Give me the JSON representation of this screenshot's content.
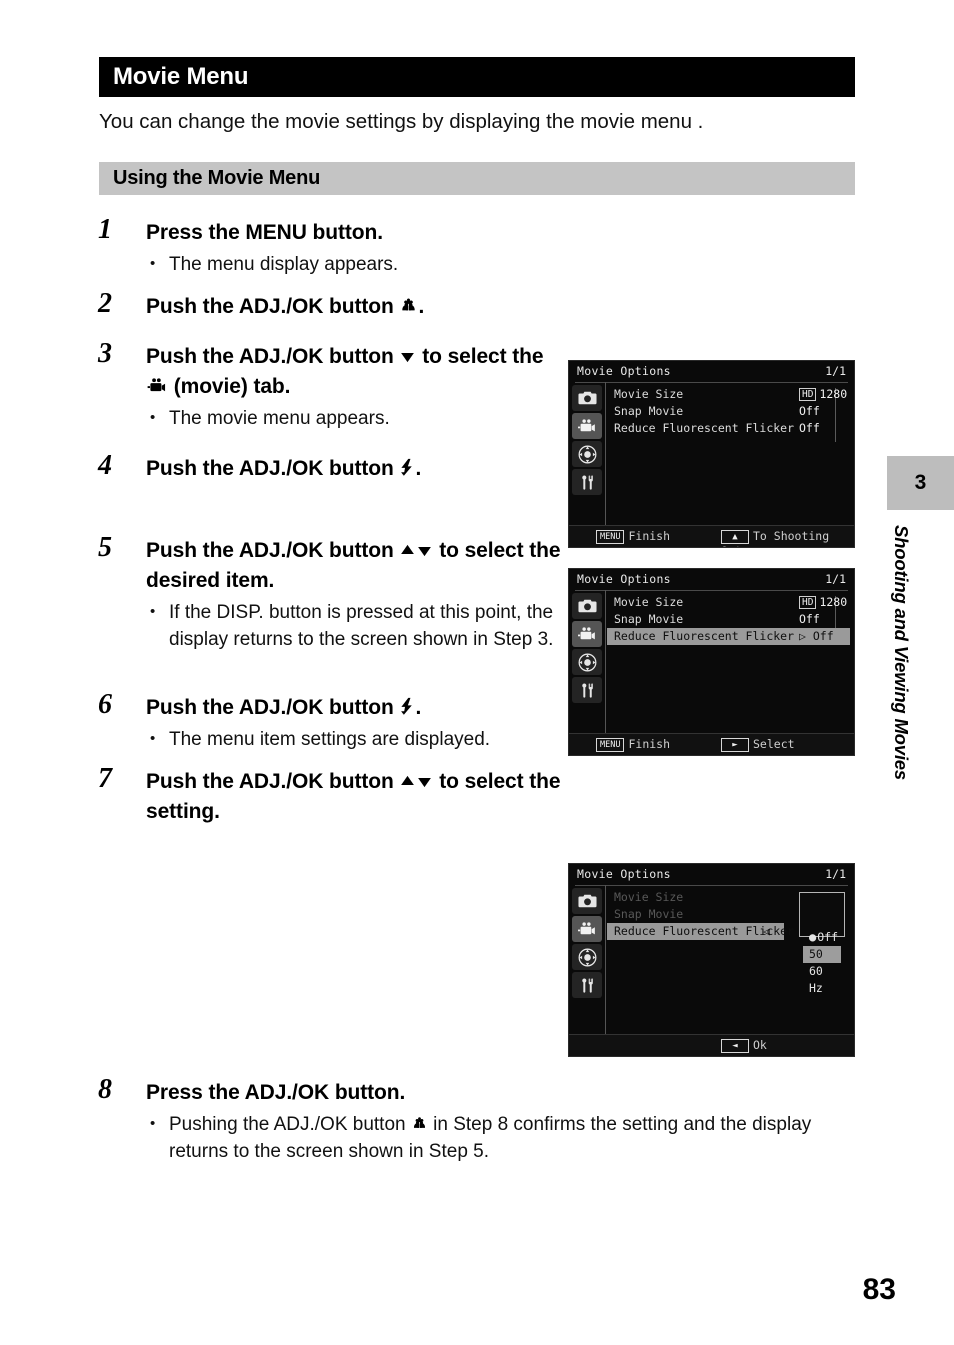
{
  "section": {
    "title": "Movie Menu",
    "intro": "You can change the movie settings by displaying the movie menu .",
    "subsection_title": "Using the  Movie Menu"
  },
  "steps": [
    {
      "num": "1",
      "title_before": "Press the MENU button.",
      "bullets": [
        "The menu display appears."
      ]
    },
    {
      "num": "2",
      "title_before": "Push the ADJ./OK button ",
      "icon": "macro-flower-icon",
      "title_after": ".",
      "bullets": []
    },
    {
      "num": "3",
      "title_before": "Push the ADJ./OK button ",
      "icon": "arrow-down-icon",
      "title_after": " to select the ",
      "icon2": "movie-camera-icon",
      "title_after2": " (movie) tab.",
      "bullets": [
        "The movie menu appears."
      ]
    },
    {
      "num": "4",
      "title_before": "Push the ADJ./OK button ",
      "icon": "flash-icon",
      "title_after": ".",
      "bullets": []
    },
    {
      "num": "5",
      "title_before": "Push the ADJ./OK button ",
      "icon": "arrow-up-down-icon",
      "title_after": " to select the desired item.",
      "bullets": [
        "If the DISP. button is pressed at this point, the display returns to the screen shown in Step 3."
      ]
    },
    {
      "num": "6",
      "title_before": "Push the ADJ./OK button ",
      "icon": "flash-icon",
      "title_after": ".",
      "bullets": [
        "The menu item settings are displayed."
      ]
    },
    {
      "num": "7",
      "title_before": "Push the ADJ./OK button ",
      "icon": "arrow-up-down-icon",
      "title_after": " to select the setting.",
      "bullets": []
    },
    {
      "num": "8",
      "title_before": "Press the ADJ./OK button.",
      "bullets_split": {
        "part1": "Pushing the ADJ./OK button ",
        "icon": "macro-flower-icon",
        "part2": " in Step 8 confirms the setting and the display returns to the screen shown in Step 5."
      }
    }
  ],
  "lcd_screens": [
    {
      "id": "screen-step3",
      "title": "Movie Options",
      "page_indicator": "1/1",
      "tabs": [
        "camera-icon",
        "movie-camera-icon",
        "adj-pad-icon",
        "setup-wrench-icon"
      ],
      "active_tab_index": 1,
      "rows": [
        {
          "label": "Movie Size",
          "value": "1280",
          "badge": "HD",
          "state": "normal"
        },
        {
          "label": "Snap Movie",
          "value": "Off",
          "state": "normal"
        },
        {
          "label": "Reduce Fluorescent Flicker",
          "value": "Off",
          "state": "normal"
        }
      ],
      "footer_left_key": "MENU",
      "footer_left_label": "Finish",
      "footer_right_key": "▲",
      "footer_right_label": "To Shooting Opt."
    },
    {
      "id": "screen-step5",
      "title": "Movie Options",
      "page_indicator": "1/1",
      "tabs": [
        "camera-icon",
        "movie-camera-icon",
        "adj-pad-icon",
        "setup-wrench-icon"
      ],
      "active_tab_index": 1,
      "rows": [
        {
          "label": "Movie Size",
          "value": "1280",
          "badge": "HD",
          "state": "normal"
        },
        {
          "label": "Snap Movie",
          "value": "Off",
          "state": "normal"
        },
        {
          "label": "Reduce Fluorescent Flicker",
          "value": "▷ Off",
          "state": "selected"
        }
      ],
      "footer_left_key": "MENU",
      "footer_left_label": "Finish",
      "footer_right_key": "►",
      "footer_right_label": "Select"
    },
    {
      "id": "screen-step7",
      "title": "Movie Options",
      "page_indicator": "1/1",
      "tabs": [
        "camera-icon",
        "movie-camera-icon",
        "adj-pad-icon",
        "setup-wrench-icon"
      ],
      "active_tab_index": 1,
      "rows": [
        {
          "label": "Movie Size",
          "value": "",
          "state": "dim"
        },
        {
          "label": "Snap Movie",
          "value": "",
          "state": "dim"
        },
        {
          "label": "Reduce Fluorescent Flicker",
          "value": "◁",
          "state": "selected"
        }
      ],
      "submenu": [
        {
          "label": "Off",
          "marker": "●",
          "state": "normal"
        },
        {
          "label": "50 Hz",
          "marker": "",
          "state": "selected"
        },
        {
          "label": "60 Hz",
          "marker": "",
          "state": "normal"
        }
      ],
      "footer_left_key": "",
      "footer_left_label": "",
      "footer_right_key": "◄",
      "footer_right_label": "Ok"
    }
  ],
  "chapter_tab": {
    "number": "3",
    "label": "Shooting and Viewing Movies"
  },
  "page_number": "83"
}
